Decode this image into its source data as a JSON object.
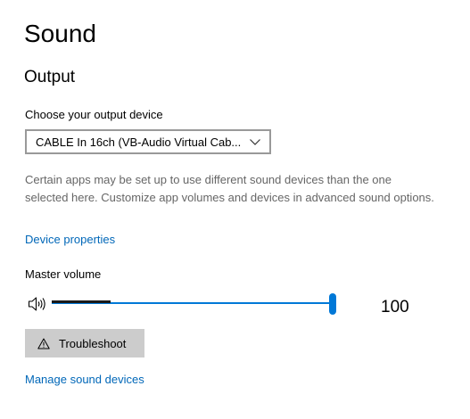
{
  "page": {
    "title": "Sound"
  },
  "output": {
    "section_title": "Output",
    "device_label": "Choose your output device",
    "selected_device": "CABLE In 16ch (VB-Audio Virtual Cab...",
    "description": "Certain apps may be set up to use different sound devices than the one selected here. Customize app volumes and devices in advanced sound options.",
    "device_properties_link": "Device properties",
    "master_volume_label": "Master volume",
    "volume_value": "100",
    "volume_level": 1.0,
    "peak_level": 0.21,
    "troubleshoot_label": "Troubleshoot",
    "manage_devices_link": "Manage sound devices"
  },
  "icons": {
    "speaker": "speaker-icon",
    "dropdown": "chevron-down-icon",
    "troubleshoot": "warning-icon"
  },
  "colors": {
    "accent": "#0078d7",
    "link": "#0067b8",
    "button_background": "#cccccc",
    "secondary_text": "#666666"
  }
}
